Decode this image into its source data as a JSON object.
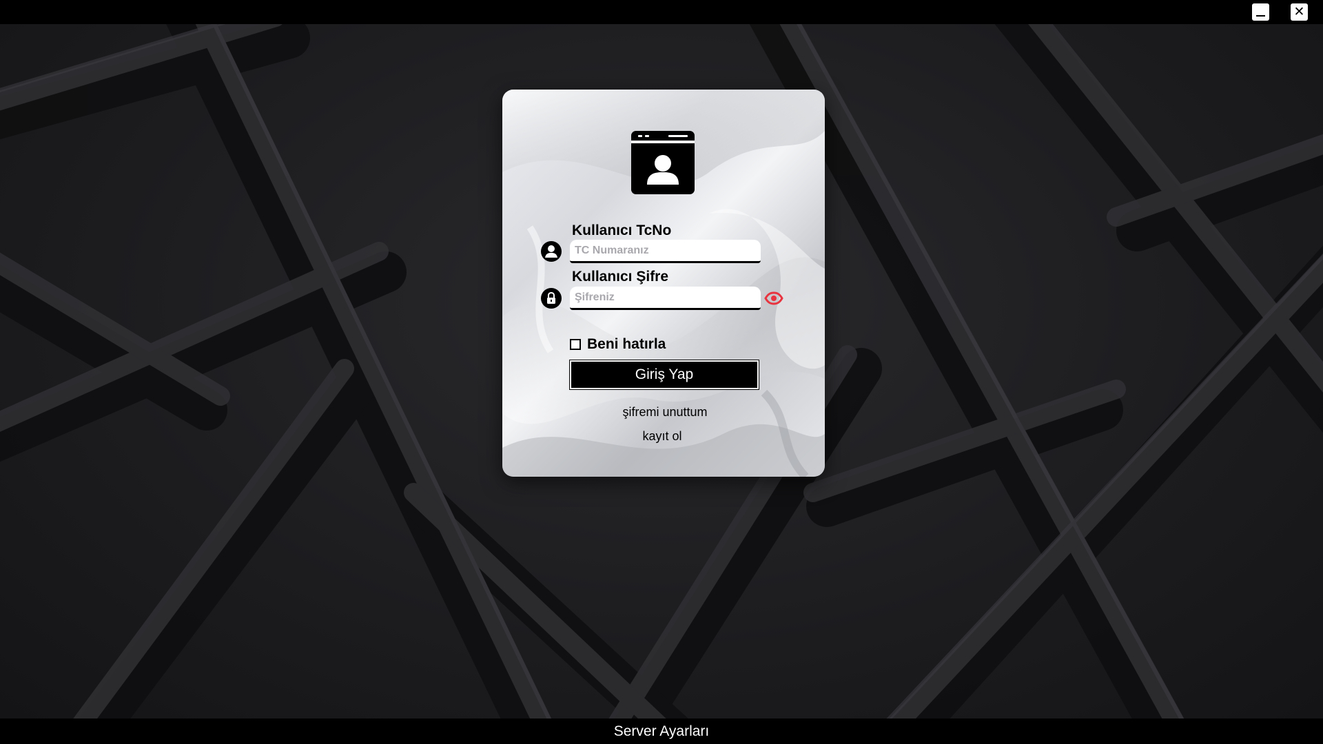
{
  "window": {
    "minimize_icon": "minimize-icon",
    "close_icon": "close-icon",
    "close_glyph": "✕"
  },
  "login": {
    "logo_icon": "user-card-icon",
    "username_label": "Kullanıcı TcNo",
    "username_placeholder": "TC Numaranız",
    "username_value": "",
    "password_label": "Kullanıcı Şifre",
    "password_placeholder": "Şifreniz",
    "password_value": "",
    "remember_label": "Beni hatırla",
    "remember_checked": false,
    "login_button": "Giriş Yap",
    "forgot_link": "şifremi unuttum",
    "register_link": "kayıt ol"
  },
  "footer": {
    "server_settings": "Server Ayarları"
  },
  "colors": {
    "accent_eye": "#e8343f",
    "button_bg": "#000000",
    "titlebar_bg": "#000000"
  }
}
